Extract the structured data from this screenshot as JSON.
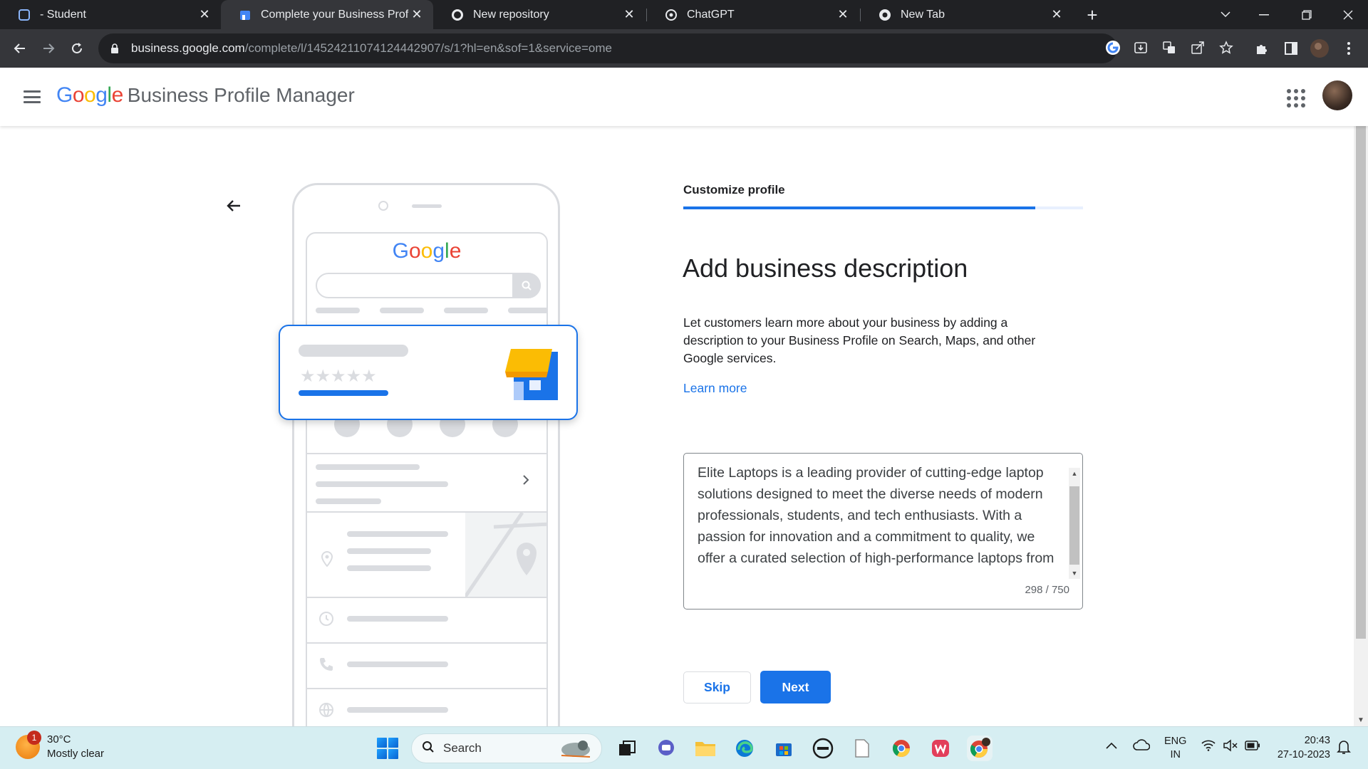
{
  "browser": {
    "tabs": [
      {
        "title": "- Student",
        "active": false
      },
      {
        "title": "Complete your Business Profile",
        "active": true
      },
      {
        "title": "New repository",
        "active": false
      },
      {
        "title": "ChatGPT",
        "active": false
      },
      {
        "title": "New Tab",
        "active": false
      }
    ],
    "url_host": "business.google.com",
    "url_path": "/complete/l/14524211074124442907/s/1?hl=en&sof=1&service=ome"
  },
  "app": {
    "logo_text": "Google",
    "product_name": "Business Profile Manager"
  },
  "illustration": {
    "logo_text": "Google",
    "stars": "★★★★★"
  },
  "step": {
    "label": "Customize profile",
    "progress_fraction": 0.88
  },
  "main": {
    "title": "Add business description",
    "description": "Let customers learn more about your business by adding a description to your Business Profile on Search, Maps, and other Google services.",
    "learn_more": "Learn more",
    "textarea_value": "Elite Laptops is a leading provider of cutting-edge laptop solutions designed to meet the diverse needs of modern professionals, students, and tech enthusiasts. With a passion for innovation and a commitment to quality, we offer a curated selection of high-performance laptops from renowned brands",
    "char_count": "298 / 750",
    "skip_label": "Skip",
    "next_label": "Next"
  },
  "taskbar": {
    "weather_temp": "30°C",
    "weather_desc": "Mostly clear",
    "weather_badge": "1",
    "search_label": "Search",
    "lang_line1": "ENG",
    "lang_line2": "IN",
    "time": "20:43",
    "date": "27-10-2023"
  },
  "colors": {
    "accent": "#1a73e8",
    "chrome_dark": "#202124",
    "chrome_toolbar": "#35363a",
    "taskbar": "#d6eef2"
  }
}
